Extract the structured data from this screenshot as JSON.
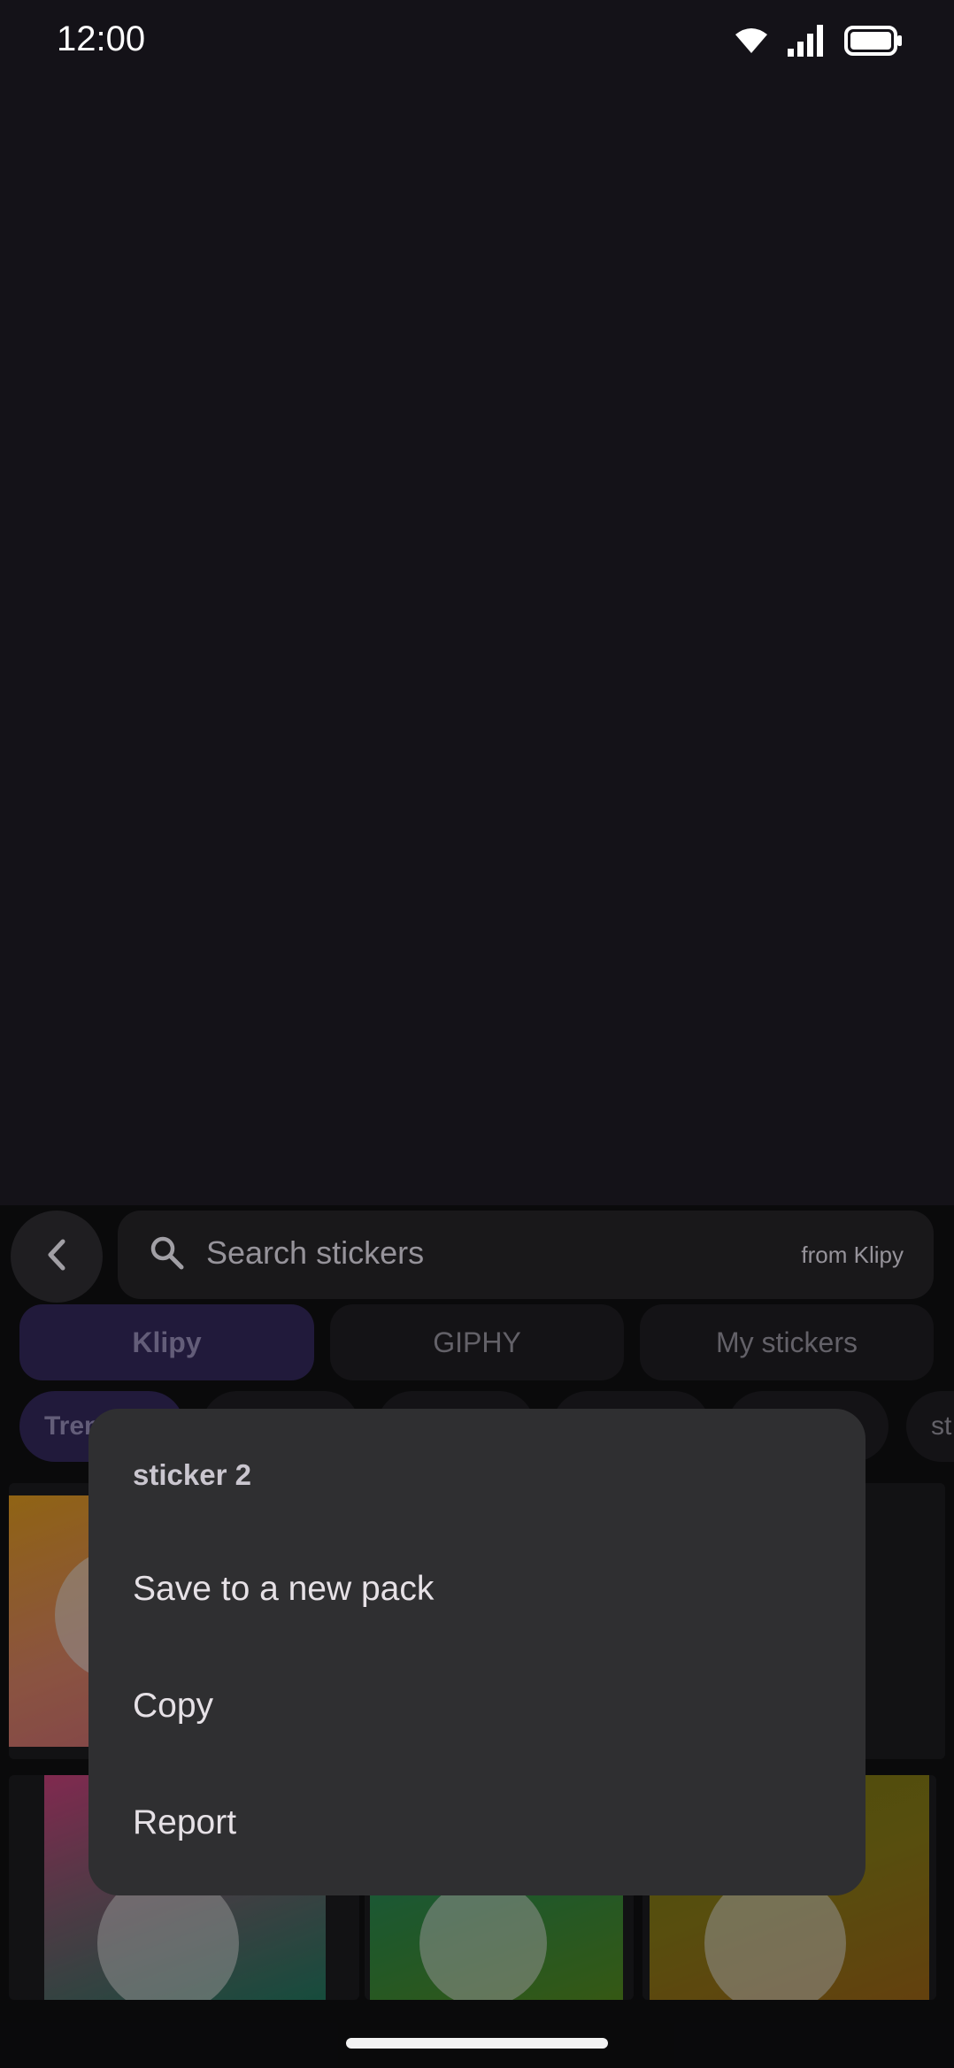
{
  "status_bar": {
    "time": "12:00",
    "icons": [
      "wifi-icon",
      "cellular-signal-icon",
      "battery-icon"
    ]
  },
  "search": {
    "placeholder": "Search stickers",
    "source_label": "from Klipy"
  },
  "provider_tabs": [
    {
      "label": "Klipy",
      "active": true
    },
    {
      "label": "GIPHY",
      "active": false
    },
    {
      "label": "My stickers",
      "active": false
    }
  ],
  "categories": [
    {
      "label": "Trending",
      "active": true
    },
    {
      "label": "",
      "active": false
    },
    {
      "label": "",
      "active": false
    },
    {
      "label": "",
      "active": false
    },
    {
      "label": "",
      "active": false
    },
    {
      "label": "st",
      "active": false
    }
  ],
  "context_menu": {
    "title": "sticker 2",
    "items": [
      {
        "label": "Save to a new pack"
      },
      {
        "label": "Copy"
      },
      {
        "label": "Report"
      }
    ]
  },
  "colors": {
    "background": "#141218",
    "accent_chip": "#2e2452",
    "menu_surface": "#2f2f31"
  }
}
